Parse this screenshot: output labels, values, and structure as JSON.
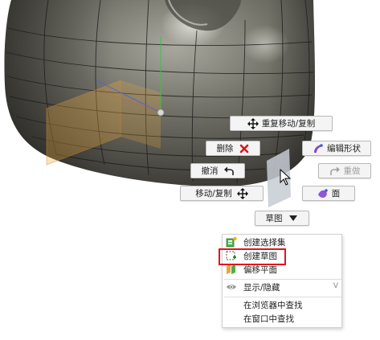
{
  "marking_menu": {
    "repeat_move_copy": "重复移动/复制",
    "delete": "删除",
    "edit_form": "编辑形状",
    "undo": "撤消",
    "redo": "重做",
    "move_copy": "移动/复制",
    "face": "面",
    "sketch": "草图"
  },
  "context_menu": {
    "items": [
      {
        "label": "创建选择集",
        "icon": "create-selection-set-icon"
      },
      {
        "label": "创建草图",
        "icon": "create-sketch-icon"
      },
      {
        "label": "偏移平面",
        "icon": "offset-plane-icon"
      },
      {
        "label": "显示/隐藏",
        "icon": "eye-icon",
        "shortcut": "V"
      },
      {
        "label": "在浏览器中查找"
      },
      {
        "label": "在窗口中查找"
      }
    ]
  },
  "colors": {
    "accent_red": "#e0141e",
    "model_surface": "#6b6a63",
    "plane_orange": "#e8a63c"
  }
}
